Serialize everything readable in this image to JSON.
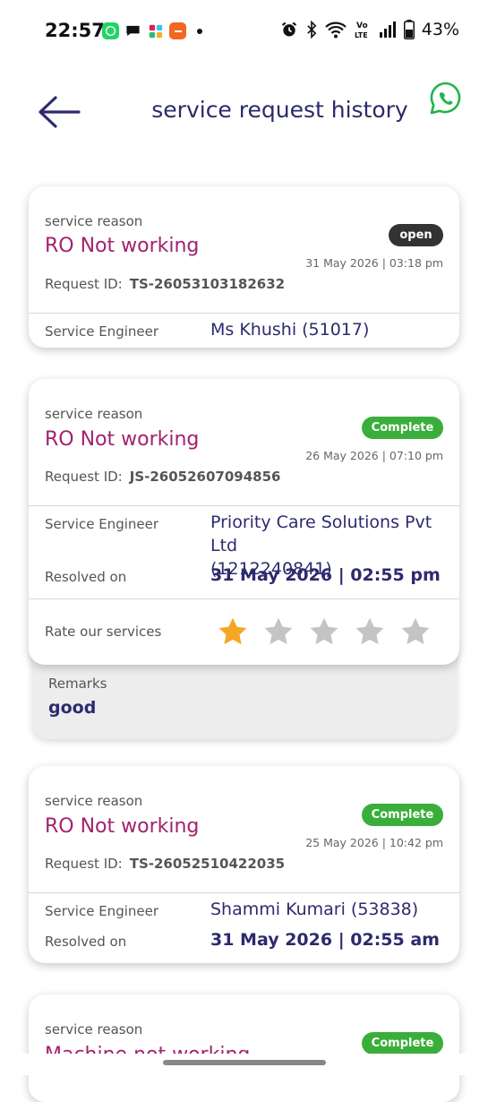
{
  "status_bar": {
    "time": "22:57",
    "battery": "43%"
  },
  "header": {
    "title": "service request history"
  },
  "labels": {
    "service_reason": "service reason",
    "request_id": "Request ID:",
    "service_engineer": "Service Engineer",
    "resolved_on": "Resolved on",
    "rate": "Rate our services",
    "remarks": "Remarks"
  },
  "requests": [
    {
      "reason": "RO Not working",
      "status": "open",
      "date": "31 May 2026 | 03:18 pm",
      "request_id": "TS-26053103182632",
      "engineer": "Ms Khushi (51017)"
    },
    {
      "reason": "RO Not working",
      "status": "Complete",
      "date": "26 May 2026 | 07:10 pm",
      "request_id": "JS-26052607094856",
      "engineer_line1": "Priority Care Solutions Pvt Ltd",
      "engineer_line2": "(1212240841)",
      "resolved_on": "31 May 2026 | 02:55 pm",
      "rating": 1,
      "rating_max": 5,
      "remarks": "good"
    },
    {
      "reason": "RO Not working",
      "status": "Complete",
      "date": "25 May 2026 | 10:42 pm",
      "request_id": "TS-26052510422035",
      "engineer": "Shammi Kumari (53838)",
      "resolved_on": "31 May 2026 | 02:55 am"
    },
    {
      "reason": "Machine not working",
      "status": "Complete"
    }
  ],
  "colors": {
    "accent": "#a2226e",
    "value_text": "#2d2a6e",
    "complete": "#3aae3a",
    "open": "#333333",
    "star_filled": "#f5a623",
    "star_empty": "#c4c4c4"
  }
}
